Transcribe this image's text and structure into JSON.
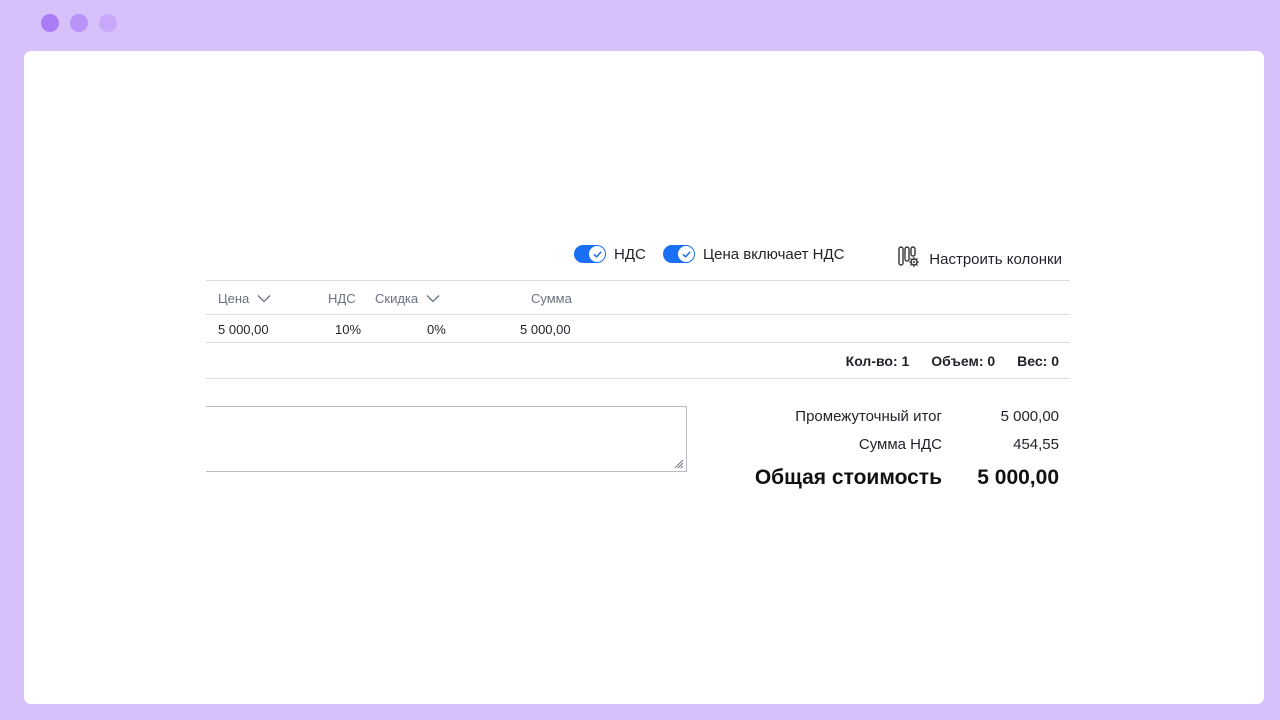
{
  "window": {
    "dots": [
      "#a97cf5",
      "#b993f7",
      "#c8a9f9"
    ]
  },
  "toolbar": {
    "vat_toggle_label": "НДС",
    "vat_toggle_on": true,
    "price_includes_vat_label": "Цена включает НДС",
    "price_includes_vat_on": true,
    "configure_columns_label": "Настроить колонки",
    "accent_color": "#1a6ff5"
  },
  "table": {
    "headers": {
      "price": "Цена",
      "vat": "НДС",
      "discount": "Скидка",
      "sum": "Сумма"
    },
    "rows": [
      {
        "price": "5 000,00",
        "vat": "10%",
        "discount": "0%",
        "sum": "5 000,00"
      }
    ]
  },
  "footer_totals": {
    "quantity": "Кол-во: 1",
    "volume": "Объем: 0",
    "weight": "Вес: 0"
  },
  "comment": {
    "value": ""
  },
  "summary": {
    "subtotal_label": "Промежуточный итог",
    "subtotal_value": "5 000,00",
    "vat_sum_label": "Сумма НДС",
    "vat_sum_value": "454,55",
    "total_label": "Общая стоимость",
    "total_value": "5 000,00"
  }
}
